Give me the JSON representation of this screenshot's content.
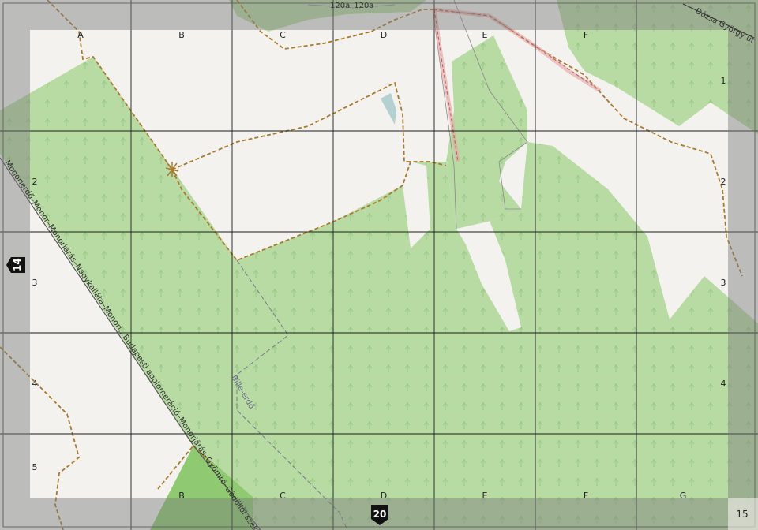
{
  "grid": {
    "columns": [
      "A",
      "B",
      "C",
      "D",
      "E",
      "F"
    ],
    "bottom_columns": [
      "B",
      "C",
      "D",
      "E",
      "F",
      "G"
    ],
    "rows_right": [
      "1",
      "2",
      "3",
      "4"
    ],
    "rows_left": [
      "2",
      "3",
      "4",
      "5"
    ]
  },
  "labels": {
    "road_top": "120a–120a",
    "street_dozsa": "Dózsa György út",
    "railway": "Monorierdő–Monor–Monorjárás–Nagykálláta–Monori...Budapesti agglomeráció–Monorjárás–Gyömrő–Gödöllői szektor",
    "forest_name": "Bille-erdő"
  },
  "page_refs": {
    "left": "14",
    "bottom": "20",
    "corner": "15"
  },
  "colors": {
    "forest": "#b8dba4",
    "meadow": "#8fca72",
    "land": "#f3f2ee",
    "border": "#a9a9a9",
    "track": "#a97a2f",
    "grid": "#1c1c1c"
  }
}
